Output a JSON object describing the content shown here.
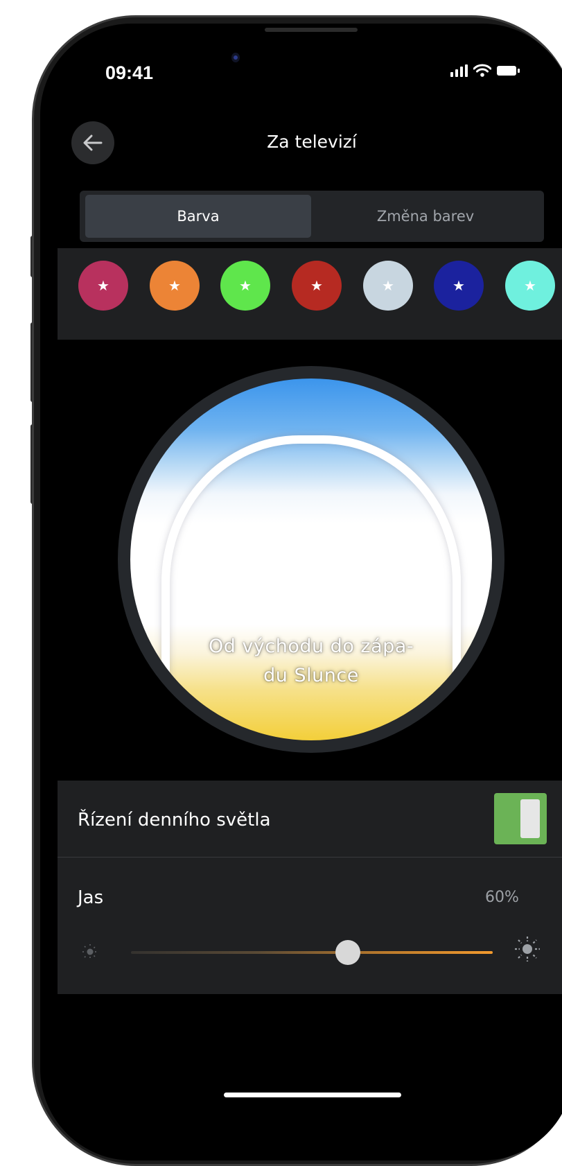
{
  "status_bar": {
    "time": "09:41"
  },
  "header": {
    "back_icon": "arrow-left-icon",
    "title": "Za televizí"
  },
  "tabs": [
    {
      "label": "Barva",
      "active": true
    },
    {
      "label": "Změna barev",
      "active": false
    }
  ],
  "favorites": [
    {
      "color": "#b8315e",
      "icon": "star-icon"
    },
    {
      "color": "#ec8436",
      "icon": "star-icon"
    },
    {
      "color": "#5fe64c",
      "icon": "star-icon"
    },
    {
      "color": "#b62a22",
      "icon": "star-icon"
    },
    {
      "color": "#c8d6e0",
      "icon": "star-icon"
    },
    {
      "color": "#1b229e",
      "icon": "star-icon"
    },
    {
      "color": "#6ff0de",
      "icon": "star-icon"
    }
  ],
  "dial": {
    "label": "Od východu do západu Slunce",
    "label_line1": "Od východu do zápa-",
    "label_line2": "du Slunce"
  },
  "daylight": {
    "label": "Řízení denního světla",
    "enabled": true
  },
  "brightness": {
    "label": "Jas",
    "value_text": "60%",
    "value": 0.6
  },
  "colors": {
    "background": "#000000",
    "panel": "#1f2022",
    "toggle_on": "#6bb356",
    "slider_accent": "#f29a2e"
  }
}
